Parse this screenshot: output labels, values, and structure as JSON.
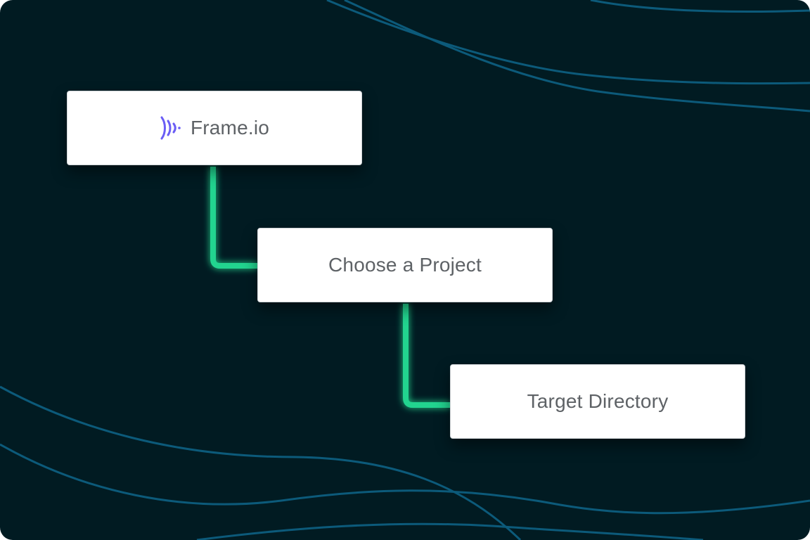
{
  "colors": {
    "background": "#011b22",
    "wave_lines": "#0c5a7a",
    "connector": "#22d48f",
    "card_background": "#ffffff",
    "card_text": "#5e6266",
    "brand_icon": "#6a5df5"
  },
  "steps": [
    {
      "label": "Frame.io",
      "icon": "frameio-logo-icon"
    },
    {
      "label": "Choose a Project"
    },
    {
      "label": "Target Directory"
    }
  ]
}
